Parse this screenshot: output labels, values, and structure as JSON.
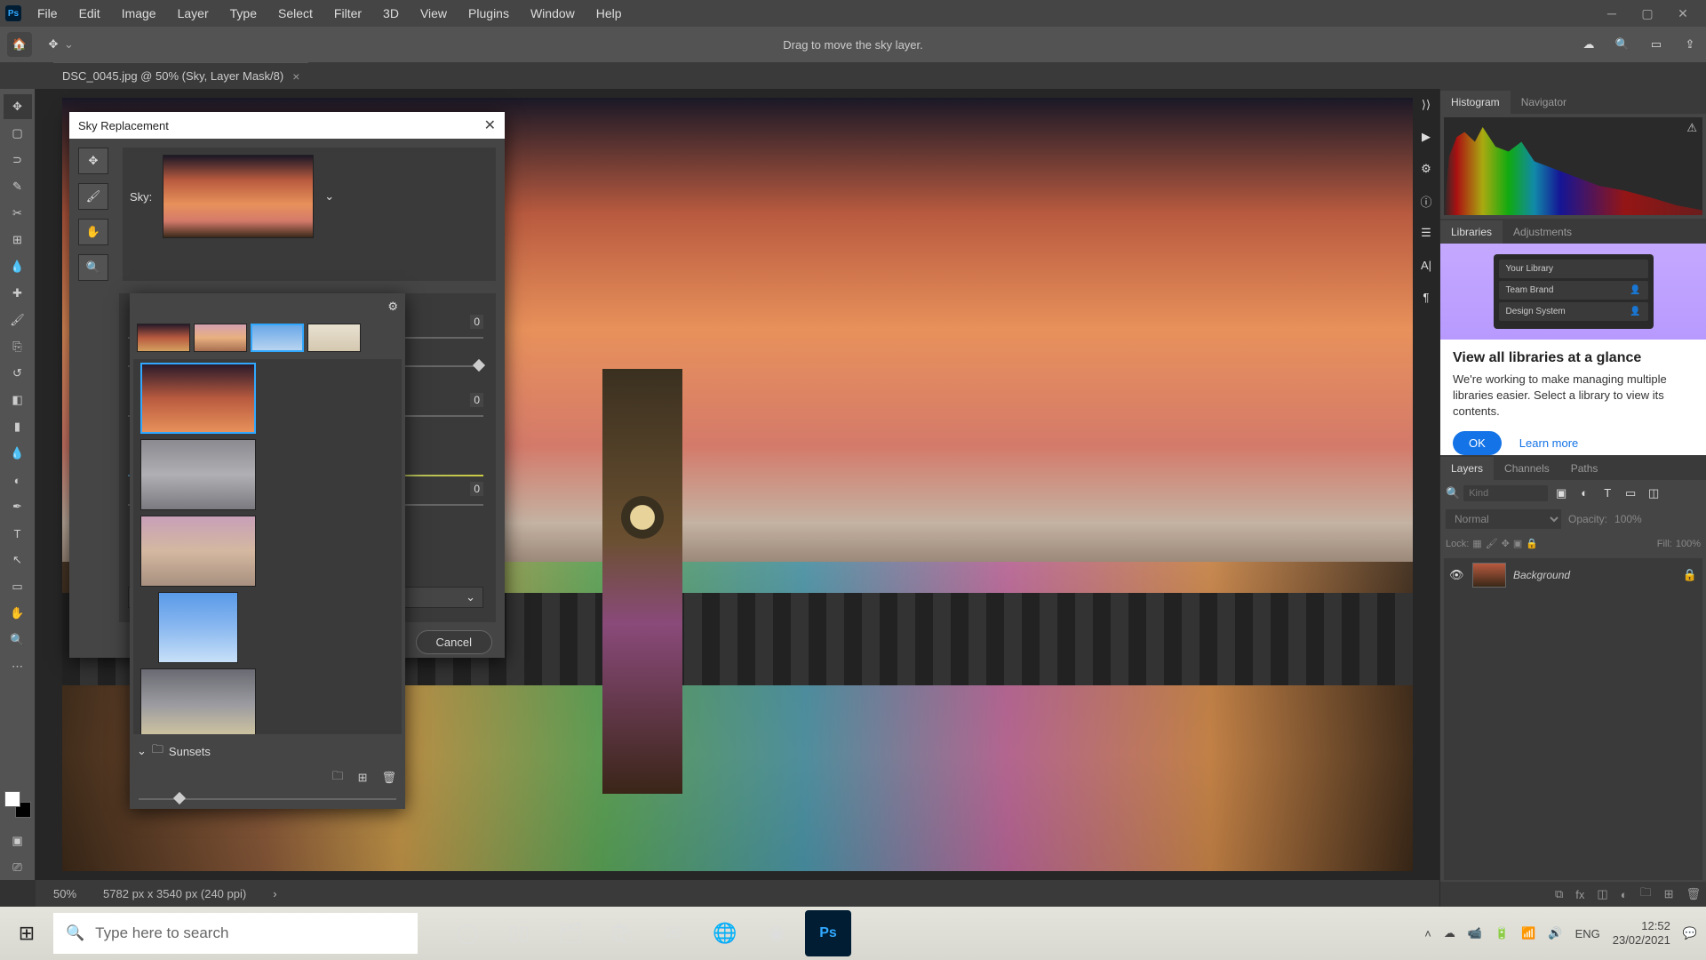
{
  "menubar": {
    "items": [
      "File",
      "Edit",
      "Image",
      "Layer",
      "Type",
      "Select",
      "Filter",
      "3D",
      "View",
      "Plugins",
      "Window",
      "Help"
    ]
  },
  "optbar": {
    "hint": "Drag to move the sky layer."
  },
  "tab": {
    "label": "DSC_0045.jpg @ 50% (Sky, Layer Mask/8)"
  },
  "status": {
    "zoom": "50%",
    "dims": "5782 px x 3540 px (240 ppi)"
  },
  "dialog": {
    "title": "Sky Replacement",
    "sky_label": "Sky:",
    "cancel": "Cancel",
    "sliders": {
      "v1": "0",
      "v2": "0",
      "v3": "0"
    }
  },
  "flyout": {
    "folder": "Sunsets"
  },
  "rpanels": {
    "histo_tabs": {
      "t1": "Histogram",
      "t2": "Navigator"
    },
    "lib_tabs": {
      "t1": "Libraries",
      "t2": "Adjustments"
    },
    "promo": {
      "rows": {
        "r0": "Your Library",
        "r1": "Team Brand",
        "r2": "Design System"
      },
      "heading": "View all libraries at a glance",
      "body": "We're working to make managing multiple libraries easier. Select a library to view its contents.",
      "ok": "OK",
      "learn": "Learn more"
    },
    "layers_tabs": {
      "t1": "Layers",
      "t2": "Channels",
      "t3": "Paths"
    },
    "layers": {
      "kind_placeholder": "Kind",
      "blend": "Normal",
      "opacity_lbl": "Opacity:",
      "opacity_val": "100%",
      "lock_lbl": "Lock:",
      "fill_lbl": "Fill:",
      "fill_val": "100%",
      "bg": "Background"
    }
  },
  "taskbar": {
    "search_placeholder": "Type here to search",
    "lang": "ENG",
    "time": "12:52",
    "date": "23/02/2021"
  }
}
